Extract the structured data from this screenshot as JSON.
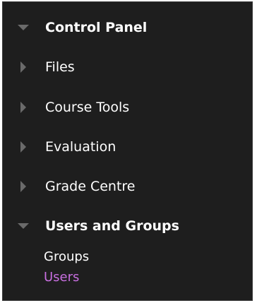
{
  "panel": {
    "title": "Control Panel",
    "items": [
      {
        "label": "Files"
      },
      {
        "label": "Course Tools"
      },
      {
        "label": "Evaluation"
      },
      {
        "label": "Grade Centre"
      }
    ],
    "expanded_section": {
      "label": "Users and Groups",
      "subitems": [
        {
          "label": "Groups"
        },
        {
          "label": "Users"
        }
      ]
    }
  },
  "colors": {
    "background": "#1e1e1e",
    "text": "#ffffff",
    "arrow": "#6a6a6a",
    "active_link": "#c86fe0"
  }
}
